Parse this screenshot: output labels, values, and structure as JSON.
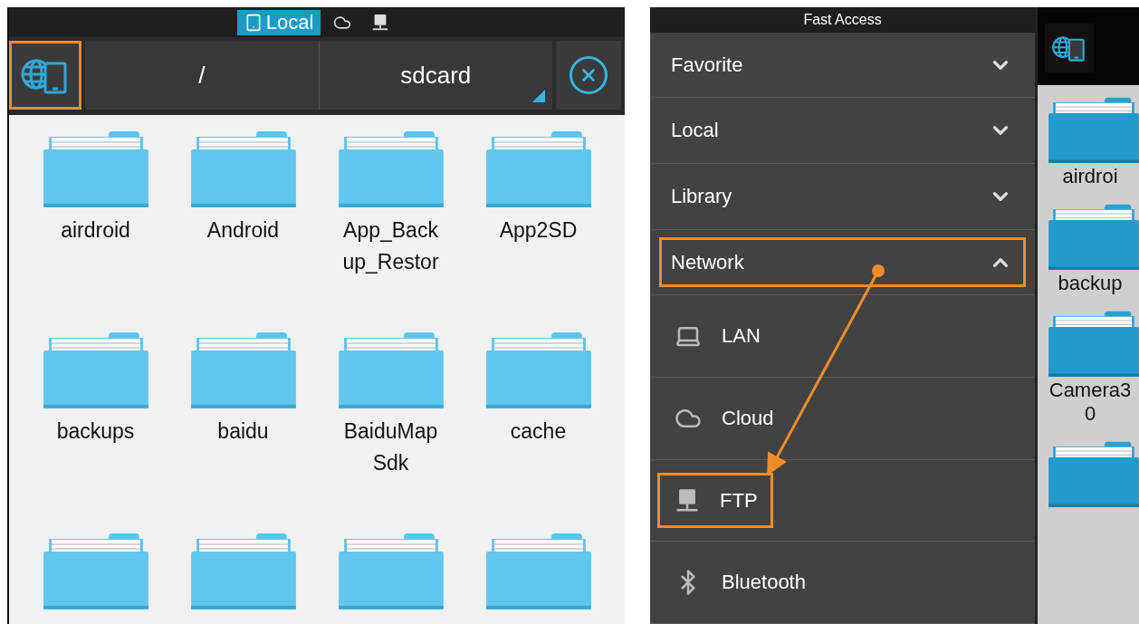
{
  "left_screen": {
    "source_tabs": [
      {
        "kind": "local",
        "label": "Local",
        "selected": true
      },
      {
        "kind": "cloud",
        "selected": false
      },
      {
        "kind": "network",
        "selected": false
      }
    ],
    "location_button": {
      "highlighted": true
    },
    "breadcrumb": [
      "/",
      "sdcard"
    ],
    "folders": [
      {
        "name": "airdroid"
      },
      {
        "name": "Android"
      },
      {
        "name": "App_Backup_Restor"
      },
      {
        "name": "App2SD"
      },
      {
        "name": "backups"
      },
      {
        "name": "baidu"
      },
      {
        "name": "BaiduMapSdk"
      },
      {
        "name": "cache"
      },
      {
        "kind": "folder"
      },
      {
        "kind": "folder"
      },
      {
        "kind": "folder"
      },
      {
        "kind": "folder"
      }
    ]
  },
  "right_screen": {
    "drawer": {
      "title": "Fast Access",
      "sections": [
        {
          "label": "Favorite",
          "expanded": false,
          "highlighted": false
        },
        {
          "label": "Local",
          "expanded": false,
          "highlighted": false
        },
        {
          "label": "Library",
          "expanded": false,
          "highlighted": false
        },
        {
          "label": "Network",
          "expanded": true,
          "highlighted": true,
          "children": [
            {
              "kind": "lan",
              "label": "LAN",
              "highlighted": false
            },
            {
              "kind": "cloud",
              "label": "Cloud",
              "highlighted": false
            },
            {
              "kind": "ftp",
              "label": "FTP",
              "highlighted": true
            },
            {
              "kind": "bluetooth",
              "label": "Bluetooth",
              "highlighted": false
            }
          ]
        }
      ]
    },
    "background_folders": [
      {
        "name": "airdroi"
      },
      {
        "name": "backup"
      },
      {
        "name": "Camera30"
      },
      {
        "kind": "folder"
      }
    ]
  }
}
